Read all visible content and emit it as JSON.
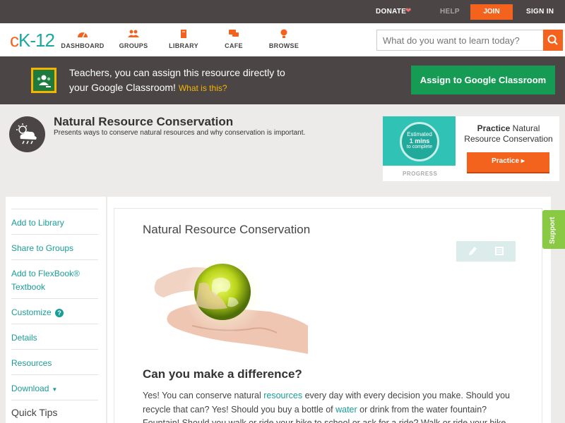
{
  "topbar": {
    "donate": "DONATE",
    "help": "HELP",
    "join": "JOIN",
    "signin": "SIGN IN"
  },
  "nav": {
    "logo_c": "c",
    "logo_k": "K-12",
    "items": [
      {
        "label": "DASHBOARD",
        "icon": "dashboard-icon"
      },
      {
        "label": "GROUPS",
        "icon": "groups-icon"
      },
      {
        "label": "LIBRARY",
        "icon": "library-icon"
      },
      {
        "label": "CAFE",
        "icon": "cafe-icon"
      },
      {
        "label": "BROWSE",
        "icon": "browse-icon"
      }
    ],
    "search_placeholder": "What do you want to learn today?"
  },
  "banner": {
    "line1": "Teachers, you can assign this resource directly to",
    "line2": "your Google Classroom!",
    "what_is_this": "What is this?",
    "assign_button": "Assign to Google Classroom"
  },
  "resource": {
    "title": "Natural Resource Conservation",
    "description": "Presents ways to conserve natural resources and why conservation is important."
  },
  "practice": {
    "estimated": "Estimated",
    "mins": "1 mins",
    "to_complete": "to complete",
    "progress_label": "PROGRESS",
    "title_bold": "Practice",
    "title_rest": "Natural Resource Conservation",
    "button": "Practice"
  },
  "sidebar": {
    "items": [
      {
        "label": "Add to Library"
      },
      {
        "label": "Share to Groups"
      },
      {
        "label": "Add to FlexBook® Textbook"
      },
      {
        "label": "Customize"
      },
      {
        "label": "Details"
      },
      {
        "label": "Resources"
      },
      {
        "label": "Download"
      }
    ],
    "quick_tips": "Quick Tips"
  },
  "content": {
    "title": "Natural Resource Conservation",
    "subheading": "Can you make a difference?",
    "p_a": "Yes! You can conserve natural ",
    "p_link1": "resources",
    "p_b": " every day with every decision you make. Should you recycle that can? Yes! Should you buy a bottle of ",
    "p_link2": "water",
    "p_c": " or drink from the water fountain? Fountain! Should you walk or ride your bike to school or ask for a ride? Walk or ride your bike."
  },
  "support": "Support",
  "colors": {
    "brand_orange": "#f4631e",
    "brand_teal": "#1a9c97",
    "google_green": "#169b54",
    "dark_bar": "#4b4645"
  }
}
